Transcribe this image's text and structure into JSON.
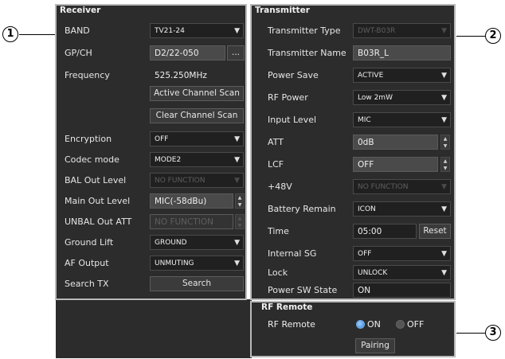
{
  "callouts": [
    "1",
    "2",
    "3"
  ],
  "receiver": {
    "title": "Receiver",
    "band": {
      "label": "BAND",
      "value": "TV21-24"
    },
    "gpch": {
      "label": "GP/CH",
      "value": "D2/22-050",
      "more": "..."
    },
    "frequency": {
      "label": "Frequency",
      "value": "525.250MHz"
    },
    "active_scan": "Active Channel Scan",
    "clear_scan": "Clear Channel Scan",
    "encryption": {
      "label": "Encryption",
      "value": "OFF"
    },
    "codec": {
      "label": "Codec mode",
      "value": "MODE2"
    },
    "bal_out": {
      "label": "BAL Out Level",
      "value": "NO FUNCTION"
    },
    "main_out": {
      "label": "Main Out Level",
      "value": "MIC(-58dBu)"
    },
    "unbal_att": {
      "label": "UNBAL Out ATT",
      "value": "NO FUNCTION"
    },
    "ground_lift": {
      "label": "Ground Lift",
      "value": "GROUND"
    },
    "af_output": {
      "label": "AF Output",
      "value": "UNMUTING"
    },
    "search_tx": {
      "label": "Search TX",
      "button": "Search"
    }
  },
  "transmitter": {
    "title": "Transmitter",
    "type": {
      "label": "Transmitter Type",
      "value": "DWT-B03R"
    },
    "name": {
      "label": "Transmitter Name",
      "value": "B03R_L"
    },
    "power_save": {
      "label": "Power Save",
      "value": "ACTIVE"
    },
    "rf_power": {
      "label": "RF Power",
      "value": "Low 2mW"
    },
    "input_level": {
      "label": "Input Level",
      "value": "MIC"
    },
    "att": {
      "label": "ATT",
      "value": "0dB"
    },
    "lcf": {
      "label": "LCF",
      "value": "OFF"
    },
    "plus48v": {
      "label": "+48V",
      "value": "NO FUNCTION"
    },
    "battery": {
      "label": "Battery Remain",
      "value": "ICON"
    },
    "time": {
      "label": "Time",
      "value": "05:00",
      "reset": "Reset"
    },
    "internal_sg": {
      "label": "Internal SG",
      "value": "OFF"
    },
    "lock": {
      "label": "Lock",
      "value": "UNLOCK"
    },
    "power_sw": {
      "label": "Power SW State",
      "value": "ON"
    }
  },
  "rf_remote": {
    "title": "RF Remote",
    "label": "RF Remote",
    "on_label": "ON",
    "off_label": "OFF",
    "selected": "ON",
    "pairing": "Pairing"
  },
  "icons": {
    "dropdown": "▼",
    "spin_up": "▲",
    "spin_down": "▼"
  },
  "colors": {
    "panel_bg": "#2c2c2c",
    "field_bg": "#4a4a4a",
    "radio_on": "#3a83d6"
  }
}
